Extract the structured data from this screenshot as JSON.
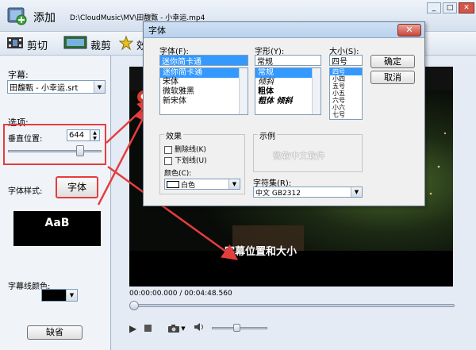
{
  "title_bar": {
    "app_label": "添加",
    "file_path": "D:\\CloudMusic\\MV\\田馥甄 - 小幸运.mp4"
  },
  "window_controls": {
    "minimize": "_",
    "maximize": "□",
    "close": "✕"
  },
  "toolbar": {
    "cut_label": "剪切",
    "crop_label": "裁剪",
    "third_label": "效"
  },
  "left_panel": {
    "subtitle_label": "字幕:",
    "subtitle_file": "田馥甄 - 小幸运.srt",
    "options_label": "选项:",
    "vertical_pos_label": "垂直位置:",
    "vertical_pos_value": "644",
    "vertical_pos_fraction": 0.8,
    "font_style_label": "字体样式:",
    "font_button": "字体",
    "preview_text": "AaB",
    "outline_color_label": "字幕线颜色:",
    "default_button": "缺省"
  },
  "player": {
    "time": "00:00:00.000 / 00:04:48.560",
    "caption_annotation": "字幕位置和大小",
    "seek_fraction": 0.0,
    "volume_fraction": 0.45
  },
  "font_dialog": {
    "title": "字体",
    "close": "✕",
    "font_label": "字体(F):",
    "font_value": "迷你简卡通",
    "fonts": [
      "迷你简卡通",
      "宋体",
      "微软雅黑",
      "新宋体"
    ],
    "selected_font_index": 0,
    "style_label": "字形(Y):",
    "style_value": "常规",
    "styles": [
      "常规",
      "倾斜",
      "粗体",
      "粗体 倾斜"
    ],
    "selected_style_index": 0,
    "size_label": "大小(S):",
    "size_value": "四号",
    "sizes": [
      "四号",
      "小四",
      "五号",
      "小五",
      "六号",
      "小六",
      "七号"
    ],
    "selected_size_index": 0,
    "ok": "确定",
    "cancel": "取消",
    "effects_label": "效果",
    "strikeout": "删除线(K)",
    "underline": "下划线(U)",
    "color_label": "颜色(C):",
    "color_value": "白色",
    "sample_label": "示例",
    "sample_text": "微软中文软件",
    "charset_label": "字符集(R):",
    "charset_value": "中文 GB2312"
  }
}
